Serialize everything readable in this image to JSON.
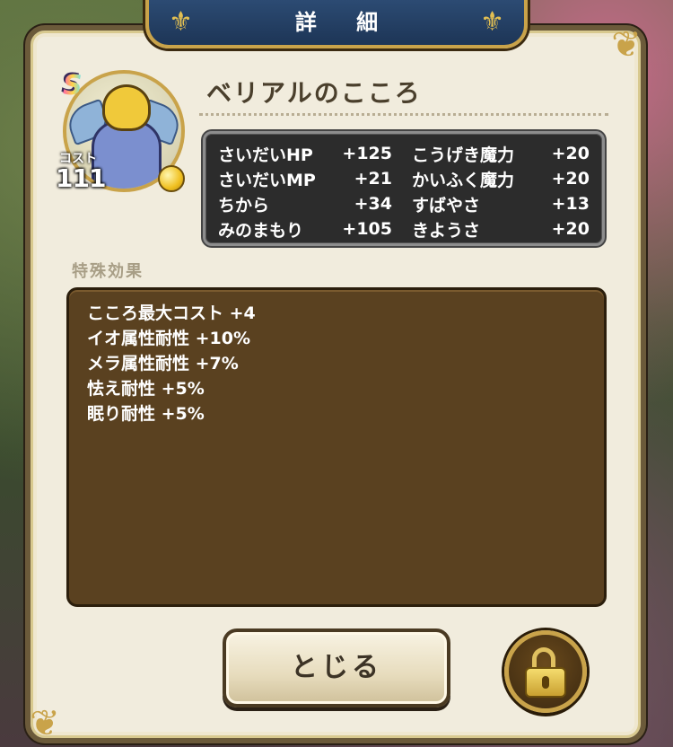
{
  "dialog": {
    "title": "詳 細",
    "close_label": "とじる"
  },
  "item": {
    "name": "ベリアルのこころ",
    "rank": "S",
    "cost_label": "コスト",
    "cost_value": "111"
  },
  "stats": [
    {
      "name": "さいだいHP",
      "value": "+125",
      "name2": "こうげき魔力",
      "value2": "+20"
    },
    {
      "name": "さいだいMP",
      "value": "+21",
      "name2": "かいふく魔力",
      "value2": "+20"
    },
    {
      "name": "ちから",
      "value": "+34",
      "name2": "すばやさ",
      "value2": "+13"
    },
    {
      "name": "みのまもり",
      "value": "+105",
      "name2": "きようさ",
      "value2": "+20"
    }
  ],
  "special": {
    "label": "特殊効果",
    "effects": [
      "こころ最大コスト +4",
      "イオ属性耐性 +10%",
      "メラ属性耐性 +7%",
      "怯え耐性 +5%",
      "眠り耐性 +5%"
    ]
  },
  "icons": {
    "lock": "lock-icon",
    "fleur": "fleur-de-lis-icon"
  },
  "colors": {
    "panel_bg": "#f1ecdd",
    "title_bg": "#2c4b73",
    "stats_bg": "#2c2c2c",
    "effects_bg": "#5a4120",
    "gold": "#c9a34a"
  }
}
